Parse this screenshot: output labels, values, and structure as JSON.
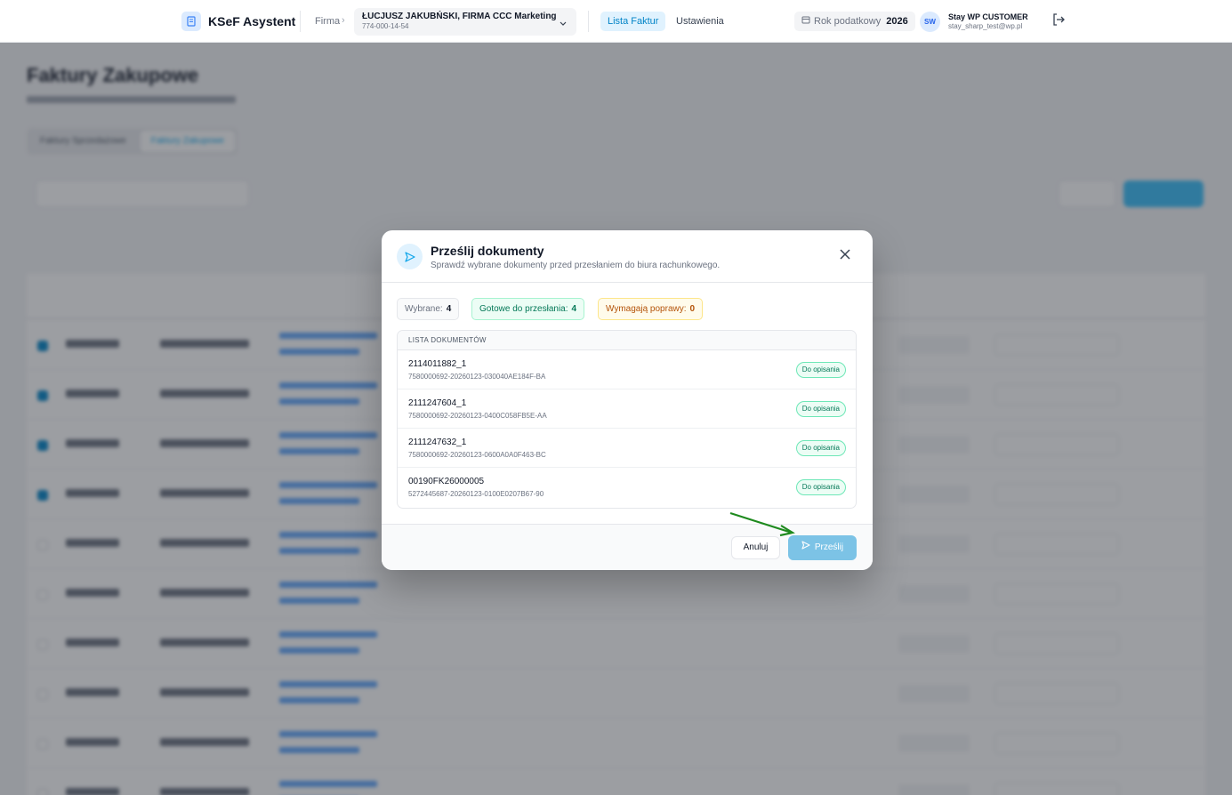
{
  "header": {
    "brand": "KSeF Asystent",
    "firma_label": "Firma",
    "company_name": "ŁUCJUSZ JAKUBŃSKI, FIRMA CCC Marketing",
    "company_nip": "774-000-14-54",
    "nav_active": "Lista Faktur",
    "nav_settings": "Ustawienia",
    "tax_year_label": "Rok podatkowy",
    "tax_year": "2026",
    "avatar": "SW",
    "user_name": "Stay WP CUSTOMER",
    "user_email": "stay_sharp_test@wp.pl",
    "icons": [
      "receipt-icon",
      "chevron-right-icon",
      "chevron-down-icon",
      "calendar-icon",
      "logout-icon"
    ]
  },
  "background": {
    "title": "Faktury Zakupowe",
    "tabs": [
      "Faktury Sprzedażowe",
      "Faktury Zakupowe"
    ],
    "rows_checked": [
      true,
      true,
      true,
      true,
      false,
      false,
      false,
      false,
      false,
      false
    ]
  },
  "modal": {
    "title": "Prześlij dokumenty",
    "subtitle": "Sprawdź wybrane dokumenty przed przesłaniem do biura rachunkowego.",
    "badges": {
      "selected_label": "Wybrane:",
      "selected_count": "4",
      "ready_label": "Gotowe do przesłania:",
      "ready_count": "4",
      "fix_label": "Wymagają poprawy:",
      "fix_count": "0"
    },
    "list_header": "LISTA DOKUMENTÓW",
    "documents": [
      {
        "number": "2114011882_1",
        "ksef": "7580000692-20260123-030040AE184F-BA",
        "status": "Do opisania"
      },
      {
        "number": "2111247604_1",
        "ksef": "7580000692-20260123-0400C058FB5E-AA",
        "status": "Do opisania"
      },
      {
        "number": "2111247632_1",
        "ksef": "7580000692-20260123-0600A0A0F463-BC",
        "status": "Do opisania"
      },
      {
        "number": "00190FK26000005",
        "ksef": "5272445687-20260123-0100E0207B67-90",
        "status": "Do opisania"
      }
    ],
    "cancel_label": "Anuluj",
    "send_label": "Prześlij",
    "accent": "#0ea5e9",
    "success": "#047857",
    "warning": "#b45309"
  }
}
